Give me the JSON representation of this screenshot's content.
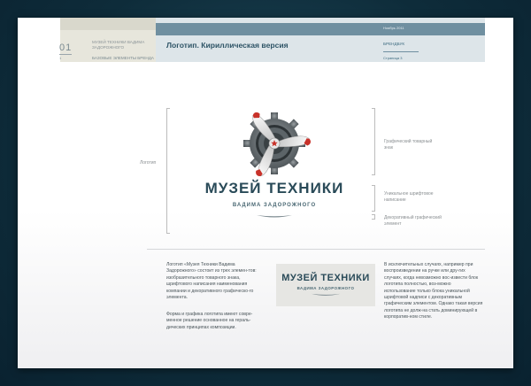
{
  "header": {
    "section_number": "01",
    "dot_label": "1",
    "brand_title": "МУЗЕЙ ТЕХНИКИ ВАДИМА ЗАДОРОЖНОГО",
    "section_name": "БАЗОВЫЕ ЭЛЕМЕНТЫ БРЕНДА",
    "page_title": "Логотип. Кириллическая версия",
    "date": "Ноябрь 2011",
    "brand_label": "БРЕНДБУК",
    "page_label": "Страница 3"
  },
  "logo_block": {
    "left_label": "Логотип",
    "main_text": "МУЗЕЙ ТЕХНИКИ",
    "sub_text": "ВАДИМА ЗАДОРОЖНОГО",
    "annotations": [
      "Графический товарный знак",
      "Уникальное шрифтовое написание",
      "Декоративный графический элемент"
    ]
  },
  "body": {
    "col1_p1": "Логотип «Музея Техники Вадима Задорожного» состоит из трех элемен-тов: изобразительного товарного знака, шрифтового написания наименования компании и декоративного графическо-го элемента.",
    "col1_p2": "Форма и графика логотипа имеют совре-менное решение основанное на гераль-дических принципах композиции.",
    "col3": "В исключительных случаях, например при воспроизведении на ручке или дру-гих случаях, когда невозможно вос-извести блок логотипа полностью, воз-можно использование только блока уникальной шрифтовой надписи с декоративным графическим элементом. Однако такая версия логотипа не долж-на стать доминирующей в корпоратив-ном стиле."
  },
  "mini_logo": {
    "main_text": "МУЗЕЙ ТЕХНИКИ",
    "sub_text": "ВАДИМА ЗАДОРОЖНОГО"
  },
  "colors": {
    "accent_dark": "#294a58",
    "header_blue": "#6f8fa0",
    "propeller_red": "#c8322a"
  }
}
